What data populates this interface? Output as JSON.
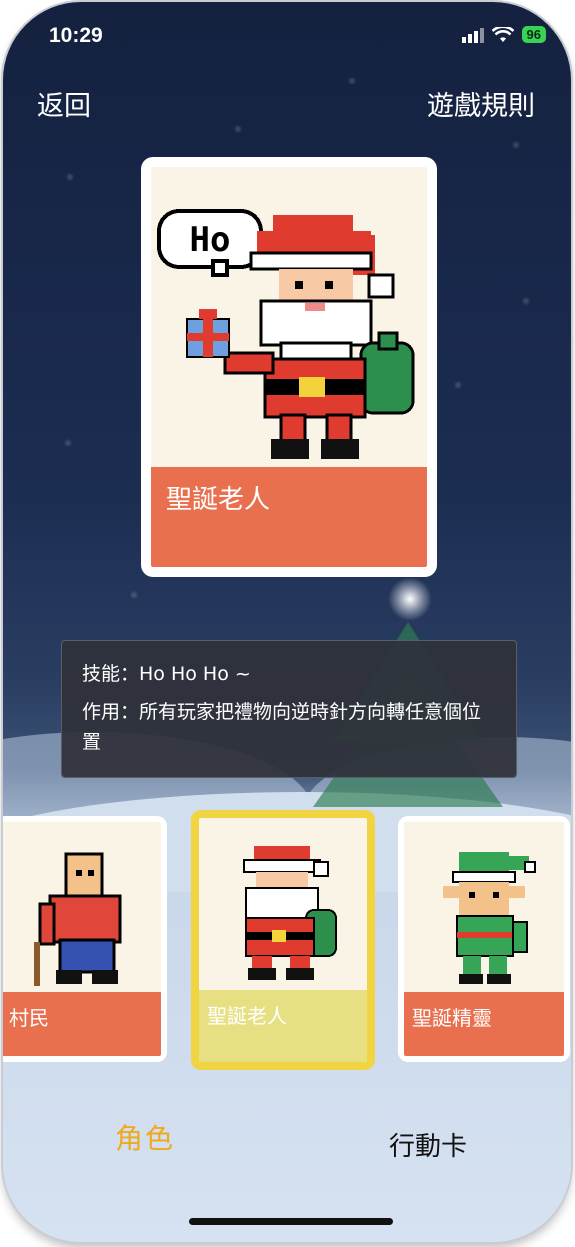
{
  "status_bar": {
    "time": "10:29",
    "battery": "96"
  },
  "nav": {
    "back_label": "返回",
    "rules_label": "遊戲規則"
  },
  "featured_card": {
    "name": "聖誕老人",
    "speech": "Ho"
  },
  "tooltip": {
    "skill": "技能：Ho Ho Ho ~",
    "effect": "作用：所有玩家把禮物向逆時針方向轉任意個位置"
  },
  "characters": [
    {
      "name": "村民",
      "icon": "villager-icon",
      "selected": false
    },
    {
      "name": "聖誕老人",
      "icon": "santa-icon",
      "selected": true
    },
    {
      "name": "聖誕精靈",
      "icon": "elf-icon",
      "selected": false
    }
  ],
  "tabs": {
    "roles_label": "角色",
    "actions_label": "行動卡"
  },
  "colors": {
    "card_name_bar": "#e9704f",
    "selected_border": "#f0d441",
    "active_tab": "#f0a81c",
    "background_dark": "#14213f"
  }
}
